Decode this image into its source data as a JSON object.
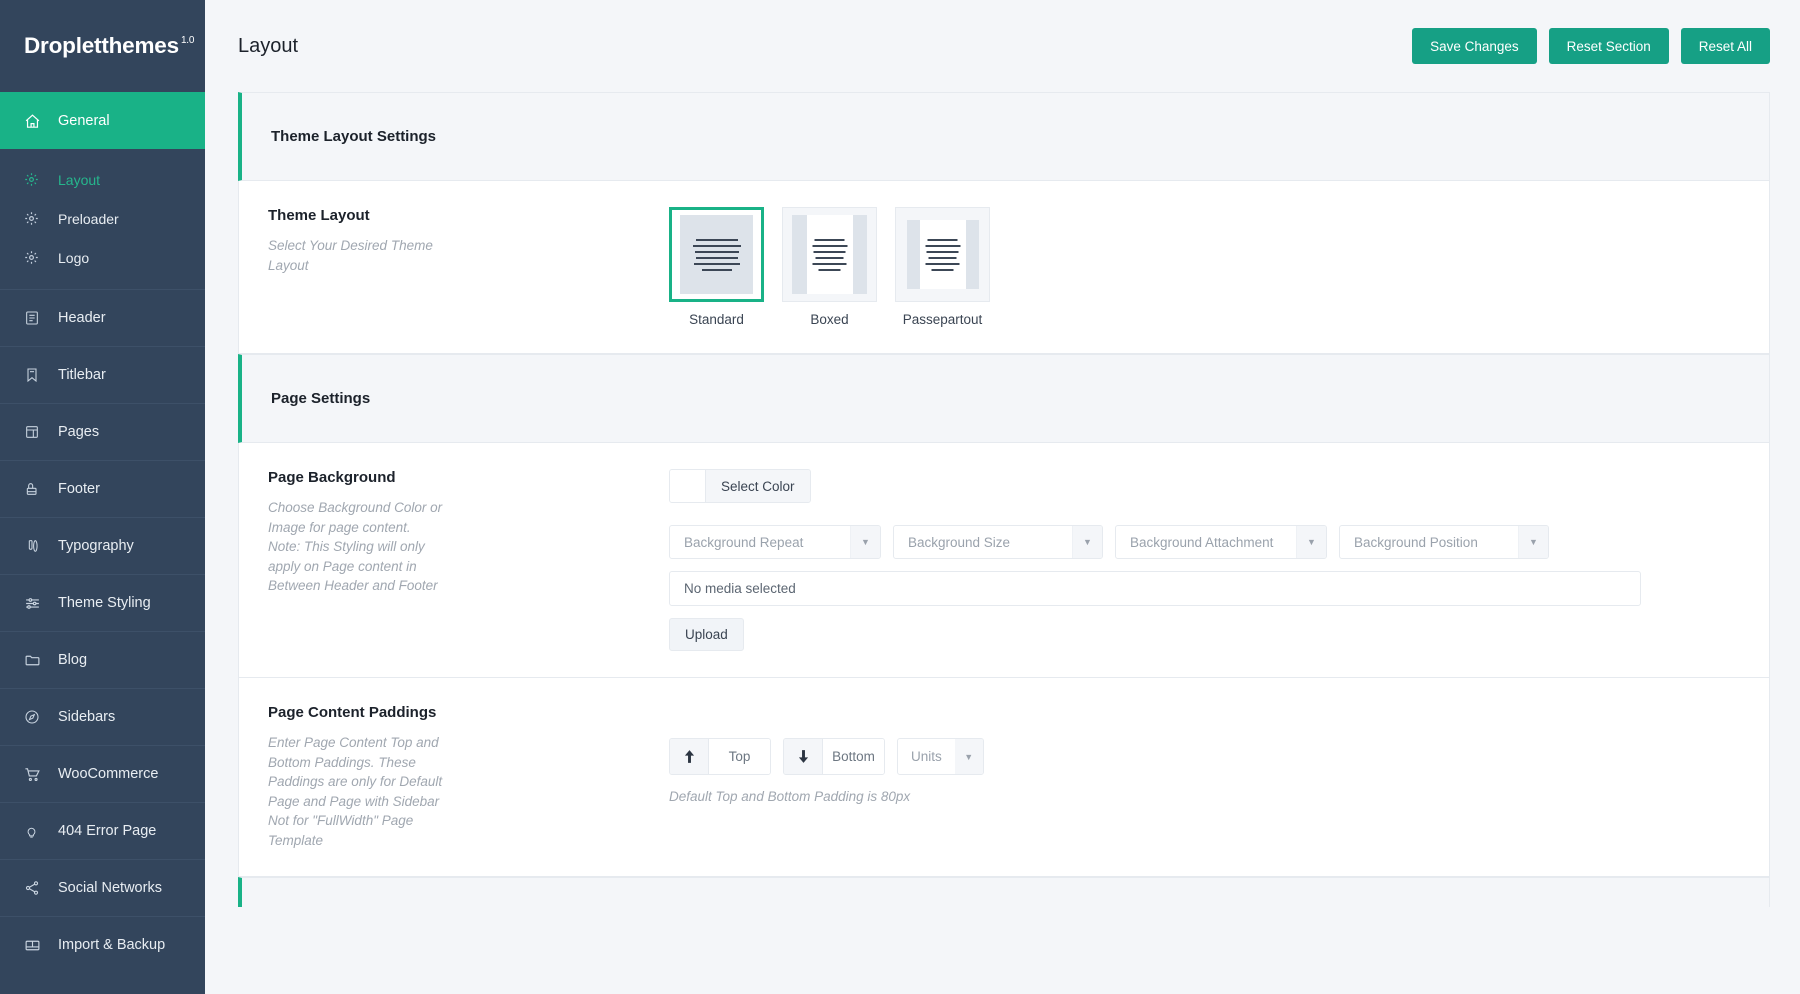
{
  "brand": {
    "name": "Dropletthemes",
    "version": "1.0"
  },
  "sidebar": {
    "items": [
      {
        "label": "General",
        "icon": "home-icon",
        "active": true
      },
      {
        "label": "Header",
        "icon": "document-lines-icon"
      },
      {
        "label": "Titlebar",
        "icon": "bookmark-icon"
      },
      {
        "label": "Pages",
        "icon": "pages-icon"
      },
      {
        "label": "Footer",
        "icon": "footer-icon"
      },
      {
        "label": "Typography",
        "icon": "typography-icon"
      },
      {
        "label": "Theme Styling",
        "icon": "sliders-icon"
      },
      {
        "label": "Blog",
        "icon": "folder-icon"
      },
      {
        "label": "Sidebars",
        "icon": "compass-icon"
      },
      {
        "label": "WooCommerce",
        "icon": "cart-icon"
      },
      {
        "label": "404 Error Page",
        "icon": "bulb-icon"
      },
      {
        "label": "Social Networks",
        "icon": "share-icon"
      },
      {
        "label": "Import & Backup",
        "icon": "drive-icon"
      }
    ],
    "subitems": [
      {
        "label": "Layout",
        "icon": "gear-icon",
        "current": true
      },
      {
        "label": "Preloader",
        "icon": "gear-icon"
      },
      {
        "label": "Logo",
        "icon": "gear-icon"
      }
    ]
  },
  "header": {
    "title": "Layout",
    "save_label": "Save Changes",
    "reset_section_label": "Reset Section",
    "reset_all_label": "Reset All"
  },
  "sections": {
    "theme_layout": {
      "heading": "Theme Layout Settings",
      "field_title": "Theme Layout",
      "field_desc": "Select Your Desired Theme Layout",
      "options": [
        {
          "label": "Standard",
          "selected": true
        },
        {
          "label": "Boxed",
          "selected": false
        },
        {
          "label": "Passepartout",
          "selected": false
        }
      ]
    },
    "page_settings": {
      "heading": "Page Settings",
      "background": {
        "field_title": "Page Background",
        "field_desc": "Choose Background Color or Image for page content. Note: This Styling will only apply on Page content in Between Header and Footer",
        "select_color_label": "Select Color",
        "swatch_color": "#ffffff",
        "dropdowns": [
          {
            "placeholder": "Background Repeat"
          },
          {
            "placeholder": "Background Size"
          },
          {
            "placeholder": "Background Attachment"
          },
          {
            "placeholder": "Background Position"
          }
        ],
        "media_text": "No media selected",
        "upload_label": "Upload"
      },
      "paddings": {
        "field_title": "Page Content Paddings",
        "field_desc": "Enter Page Content Top and Bottom Paddings. These Paddings are only for Default Page and Page with Sidebar Not for \"FullWidth\" Page Template",
        "top_placeholder": "Top",
        "top_value": "",
        "bottom_placeholder": "Bottom",
        "bottom_value": "",
        "units_label": "Units",
        "note": "Default Top and Bottom Padding is 80px"
      }
    }
  },
  "colors": {
    "accent": "#19b287",
    "sidebar": "#33455c",
    "button": "#16a085"
  }
}
